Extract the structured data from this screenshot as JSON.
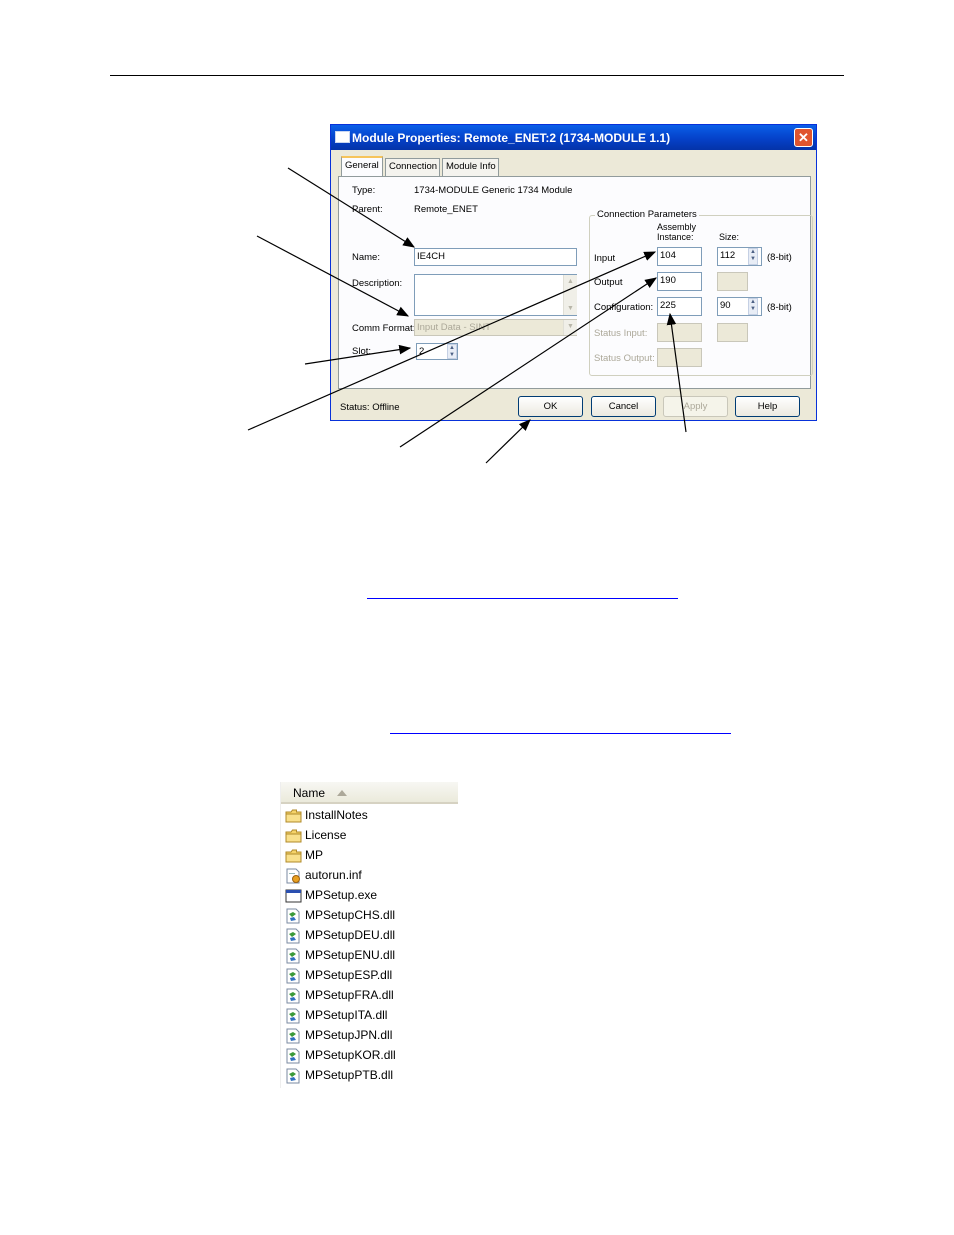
{
  "dialog": {
    "title": "Module Properties: Remote_ENET:2 (1734-MODULE 1.1)",
    "tabs": [
      "General",
      "Connection",
      "Module Info"
    ],
    "type_label": "Type:",
    "type_value": "1734-MODULE Generic 1734 Module",
    "parent_label": "Parent:",
    "parent_value": "Remote_ENET",
    "name_label": "Name:",
    "name_value": "IE4CH",
    "description_label": "Description:",
    "description_value": "",
    "comm_format_label": "Comm Format:",
    "comm_format_value": "Input Data - SINT",
    "slot_label": "Slot:",
    "slot_value": "2",
    "connection_params": {
      "group_label": "Connection Parameters",
      "assembly_header_1": "Assembly",
      "assembly_header_2": "Instance:",
      "size_header": "Size:",
      "rows": [
        {
          "label": "Input",
          "instance": "104",
          "size": "112",
          "unit": "(8-bit)"
        },
        {
          "label": "Output",
          "instance": "190",
          "size": "",
          "unit": ""
        },
        {
          "label": "Configuration:",
          "instance": "225",
          "size": "90",
          "unit": "(8-bit)"
        },
        {
          "label": "Status Input:",
          "instance": "",
          "size": "",
          "unit": ""
        },
        {
          "label": "Status Output:",
          "instance": "",
          "size": "",
          "unit": ""
        }
      ]
    },
    "status_text": "Status:  Offline",
    "buttons": {
      "ok": "OK",
      "cancel": "Cancel",
      "apply": "Apply",
      "help": "Help"
    },
    "close_glyph": "✕"
  },
  "file_list": {
    "column_header": "Name",
    "items": [
      {
        "name": "InstallNotes",
        "icon": "folder-icon"
      },
      {
        "name": "License",
        "icon": "folder-icon"
      },
      {
        "name": "MP",
        "icon": "folder-icon"
      },
      {
        "name": "autorun.inf",
        "icon": "inf-file-icon"
      },
      {
        "name": "MPSetup.exe",
        "icon": "exe-file-icon"
      },
      {
        "name": "MPSetupCHS.dll",
        "icon": "dll-file-icon"
      },
      {
        "name": "MPSetupDEU.dll",
        "icon": "dll-file-icon"
      },
      {
        "name": "MPSetupENU.dll",
        "icon": "dll-file-icon"
      },
      {
        "name": "MPSetupESP.dll",
        "icon": "dll-file-icon"
      },
      {
        "name": "MPSetupFRA.dll",
        "icon": "dll-file-icon"
      },
      {
        "name": "MPSetupITA.dll",
        "icon": "dll-file-icon"
      },
      {
        "name": "MPSetupJPN.dll",
        "icon": "dll-file-icon"
      },
      {
        "name": "MPSetupKOR.dll",
        "icon": "dll-file-icon"
      },
      {
        "name": "MPSetupPTB.dll",
        "icon": "dll-file-icon"
      }
    ]
  },
  "colors": {
    "titlebar": "#0541c9",
    "dialog_bg": "#ece9d8",
    "link": "#0000ff",
    "folder": "#f5d36a"
  }
}
